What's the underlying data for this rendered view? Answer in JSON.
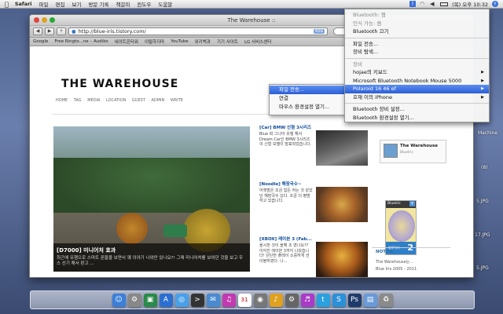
{
  "menubar": {
    "app": "Safari",
    "items": [
      "파일",
      "편집",
      "보기",
      "방문 기록",
      "책갈피",
      "윈도우",
      "도움말"
    ],
    "clock": "(목) 오후 10:32",
    "icons": [
      "bluetooth-icon",
      "wifi-icon",
      "volume-icon",
      "battery-icon",
      "spotlight-icon"
    ]
  },
  "window": {
    "title": "The Warehouse ::",
    "url": "http://blue-iris.tistory.com/",
    "rss": "RSS",
    "bookmarks": [
      "Google",
      "Free Ringto...ne – Audiko",
      "네이트온타워",
      "이탈하지마",
      "YouTube",
      "위키백과",
      "기기 사이트",
      "LG 서비스센터"
    ]
  },
  "blog": {
    "title": "THE WAREHOUSE",
    "nav": [
      "HOME",
      "TAG",
      "MEDIA",
      "LOCATION",
      "GUEST",
      "ADMIN",
      "WRITE"
    ],
    "hero": {
      "title": "[D7000] 미니어처 효과",
      "desc": "최근에 유행으로 스마트 폰들을 보면서 꽤 이야기 나와만 있나요?! 그래 미니어처를 보여던 것을 보고 우스 선기 해서 판고 ..."
    },
    "posts": [
      {
        "title": "[Car] BMW 신형 3시리즈",
        "body": "Blue 회 그나아 유행 해서 Dream Car인 BMW 3시리즈의 신형 모델이 발표되었습니다."
      },
      {
        "title": "[Noodle] 해장국수~",
        "body": "어젯밤은 조금 힘든 하는 것 같았던 해장국수 있다. 조금 더 평범 하고 있습니다."
      },
      {
        "title": "[XBOX] 레이븐 3 (Fab...",
        "body": "올시한 것이 올해 초 였나요?? 이어진 레이븐 3까지 나왔습니다! 단단한 플레이 소중하게 언이블하였다. 나..."
      }
    ],
    "profile": {
      "name": "The Warehouse",
      "sub": "BlueIris"
    },
    "widget": {
      "head": "Blueiris",
      "label": "방문하기",
      "count": "2"
    },
    "notice": {
      "title": "NOTICE",
      "line1": "The Warehouse는...",
      "line2": "Blue Iris 2005 - 2011"
    }
  },
  "desktop": {
    "labels": [
      "Machine",
      "(8)",
      "5.JPG",
      "17.JPG",
      "5.JPG"
    ]
  },
  "context_menu": {
    "items": [
      "파일 전송...",
      "연결",
      "마우스 환경설정 열기..."
    ],
    "highlighted": 0
  },
  "bluetooth_menu": {
    "status": "Bluetooth: 켬",
    "discoverable": "인식 가능: 켬",
    "toggle": "Bluetooth 끄기",
    "send_file": "파일 전송...",
    "browse": "장비 탐색...",
    "devices_header": "장비",
    "devices": [
      "hojae의 키보드",
      "Microsoft Bluetooth Notebook Mouse 5000",
      "Polaroid 16 46 ef",
      "호재 이의 iPhone"
    ],
    "highlighted_device": 2,
    "setup": "Bluetooth 장비 설정...",
    "prefs": "Bluetooth 환경설정 열기..."
  },
  "dock": {
    "icons": [
      "finder-icon",
      "system-prefs-icon",
      "iphoto-icon",
      "appstore-icon",
      "safari-icon",
      "terminal-icon",
      "mail-icon",
      "itunes-icon",
      "calendar-icon",
      "camera-icon",
      "music-icon",
      "gear-icon",
      "itunes2-icon",
      "twitter-icon",
      "skype-icon",
      "photoshop-icon",
      "folder-icon",
      "trash-icon"
    ],
    "colors": [
      "#3b7fd8",
      "#888888",
      "#2a8a4a",
      "#2a6fd0",
      "#4aa0e8",
      "#333333",
      "#4a8ad0",
      "#c23ab0",
      "#d84a3a",
      "#777777",
      "#e0a020",
      "#666666",
      "#aa3ac8",
      "#2aa0e0",
      "#2a90d8",
      "#1e3a6a",
      "#6a9ad8",
      "#8a8a8a"
    ]
  }
}
